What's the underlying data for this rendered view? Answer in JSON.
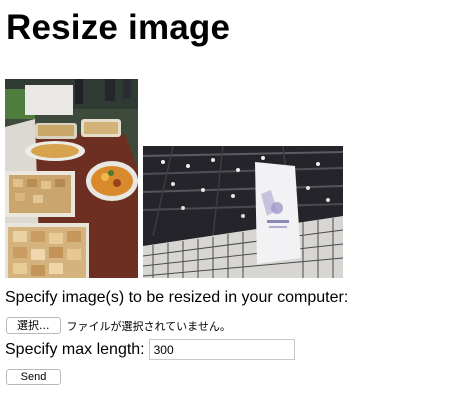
{
  "page": {
    "title": "Resize image"
  },
  "images": [
    {
      "alt": "food-buffet-photo"
    },
    {
      "alt": "hall-banner-photo"
    }
  ],
  "form": {
    "files_label": "Specify image(s) to be resized in your computer:",
    "file_button_label": "選択...",
    "file_status": "ファイルが選択されていません。",
    "max_length_label": "Specify max length:",
    "max_length_value": "300",
    "submit_label": "Send"
  }
}
